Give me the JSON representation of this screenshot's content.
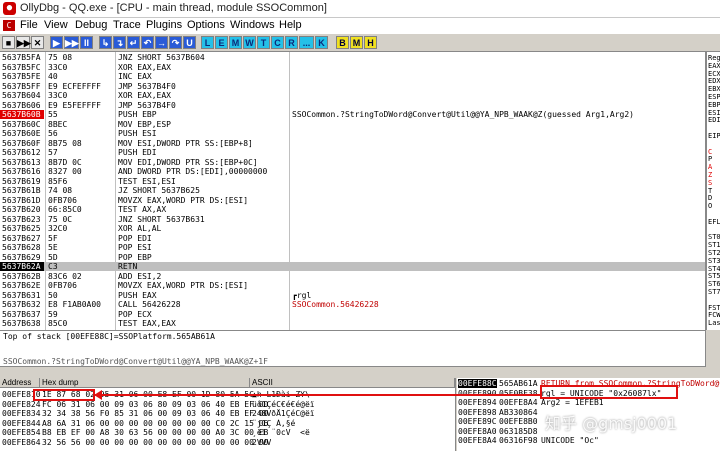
{
  "window": {
    "title": "OllyDbg - QQ.exe - [CPU - main thread, module SSOCommon]"
  },
  "menu": [
    "File",
    "View",
    "Debug",
    "Trace",
    "Plugins",
    "Options",
    "Windows",
    "Help"
  ],
  "toolbar": {
    "buttons": [
      "▶▶",
      "■",
      "✕",
      "▶",
      "▶▶",
      "II",
      "↳",
      "↴",
      "↵",
      "↶",
      "→",
      "↷",
      "U"
    ],
    "letters": [
      "L",
      "E",
      "M",
      "W",
      "T",
      "C",
      "R",
      "...",
      "K",
      "B",
      "M",
      "H"
    ]
  },
  "cpu_rows": [
    {
      "addr": "5637B5FA",
      "bytes": "75 08",
      "dis": "JNZ SHORT 5637B604",
      "cmt": ""
    },
    {
      "addr": "5637B5FC",
      "bytes": "33C0",
      "dis": "XOR EAX,EAX",
      "cmt": ""
    },
    {
      "addr": "5637B5FE",
      "bytes": "40",
      "dis": "INC EAX",
      "cmt": ""
    },
    {
      "addr": "5637B5FF",
      "bytes": "E9 ECFEFFFF",
      "dis": "JMP 5637B4F0",
      "cmt": ""
    },
    {
      "addr": "5637B604",
      "bytes": "33C0",
      "dis": "XOR EAX,EAX",
      "cmt": ""
    },
    {
      "addr": "5637B606",
      "bytes": "E9 E5FEFFFF",
      "dis": "JMP 5637B4F0",
      "cmt": ""
    },
    {
      "addr": "5637B60B",
      "bytes": "55",
      "dis": "PUSH EBP",
      "cmt": "SSOCommon.?StringToDWord@Convert@Util@@YA_NPB_WAAK@Z(guessed Arg1,Arg2)"
    },
    {
      "addr": "5637B60C",
      "bytes": "8BEC",
      "dis": "MOV EBP,ESP",
      "cmt": ""
    },
    {
      "addr": "5637B60E",
      "bytes": "56",
      "dis": "PUSH ESI",
      "cmt": ""
    },
    {
      "addr": "5637B60F",
      "bytes": "8B75 08",
      "dis": "MOV ESI,DWORD PTR SS:[EBP+8]",
      "cmt": ""
    },
    {
      "addr": "5637B612",
      "bytes": "57",
      "dis": "PUSH EDI",
      "cmt": ""
    },
    {
      "addr": "5637B613",
      "bytes": "8B7D 0C",
      "dis": "MOV EDI,DWORD PTR SS:[EBP+0C]",
      "cmt": ""
    },
    {
      "addr": "5637B616",
      "bytes": "8327 00",
      "dis": "AND DWORD PTR DS:[EDI],00000000",
      "cmt": ""
    },
    {
      "addr": "5637B619",
      "bytes": "85F6",
      "dis": "TEST ESI,ESI",
      "cmt": ""
    },
    {
      "addr": "5637B61B",
      "bytes": "74 08",
      "dis": "JZ SHORT 5637B625",
      "cmt": ""
    },
    {
      "addr": "5637B61D",
      "bytes": "0FB706",
      "dis": "MOVZX EAX,WORD PTR DS:[ESI]",
      "cmt": ""
    },
    {
      "addr": "5637B620",
      "bytes": "66:85C0",
      "dis": "TEST AX,AX",
      "cmt": ""
    },
    {
      "addr": "5637B623",
      "bytes": "75 0C",
      "dis": "JNZ SHORT 5637B631",
      "cmt": ""
    },
    {
      "addr": "5637B625",
      "bytes": "32C0",
      "dis": "XOR AL,AL",
      "cmt": ""
    },
    {
      "addr": "5637B627",
      "bytes": "5F",
      "dis": "POP EDI",
      "cmt": ""
    },
    {
      "addr": "5637B628",
      "bytes": "5E",
      "dis": "POP ESI",
      "cmt": ""
    },
    {
      "addr": "5637B629",
      "bytes": "5D",
      "dis": "POP EBP",
      "cmt": ""
    },
    {
      "addr": "5637B62A",
      "bytes": "C3",
      "dis": "RETN",
      "cmt": ""
    },
    {
      "addr": "5637B62B",
      "bytes": "83C6 02",
      "dis": "ADD ESI,2",
      "cmt": ""
    },
    {
      "addr": "5637B62E",
      "bytes": "0FB706",
      "dis": "MOVZX EAX,WORD PTR DS:[ESI]",
      "cmt": ""
    },
    {
      "addr": "5637B631",
      "bytes": "50",
      "dis": "PUSH EAX",
      "cmt": "┏rgl"
    },
    {
      "addr": "5637B632",
      "bytes": "E8 F1AB0A00",
      "dis": "CALL 56426228",
      "cmt": "SSOCommon.56426228"
    },
    {
      "addr": "5637B637",
      "bytes": "59",
      "dis": "POP ECX",
      "cmt": ""
    },
    {
      "addr": "5637B638",
      "bytes": "85C0",
      "dis": "TEST EAX,EAX",
      "cmt": ""
    }
  ],
  "registers": [
    "Reg",
    "EAX",
    "ECX",
    "EDX",
    "EBX",
    "ESP",
    "EBP",
    "ESI",
    "EDI",
    "",
    "EIP",
    "",
    "C",
    "P",
    "A",
    "Z",
    "S",
    "T",
    "D",
    "O",
    "",
    "EFL",
    "",
    "ST0",
    "ST1",
    "ST2",
    "ST3",
    "ST4",
    "ST5",
    "ST6",
    "ST7",
    "",
    "FST",
    "FCW",
    "Las"
  ],
  "info": {
    "line1": "Top of stack [00EFE88C]=SSOPlatform.565AB61A",
    "line2": "SSOCommon.?StringToDWord@Convert@Util@@YA_NPB_WAAK@Z+1F"
  },
  "dump": {
    "headers": [
      "Address",
      "Hex dump",
      "ASCII"
    ],
    "rows": [
      {
        "addr": "00EFE810",
        "hex": "1E 87 68 02 95 31 06 00 E8 EF 00 1D 80 5A 5C",
        "ascii": "▲h L1Ðài  ZY\\"
      },
      {
        "addr": "00EFE824",
        "hex": "FC 06 31 06 00 09 03 06 80 09 03 06 40 EB EF 00",
        "ascii": "üô1ÇéC€é€é@ëï"
      },
      {
        "addr": "00EFE834",
        "hex": "32 34 38 56 F0 85 31 06 00 09 03 06 40 EB EF 00",
        "ascii": "248VðÅ1ÇéC@ëï"
      },
      {
        "addr": "00EFE844",
        "hex": "A8 6A 31 06 00 00 00 00 00 00 00 00 C0 2C 15 06",
        "ascii": "¨j1Ç À,§é"
      },
      {
        "addr": "00EFE854",
        "hex": "B8 EB EF 00 A8 30 63 56 00 00 00 00 A0 3C 00 EB",
        "ascii": "¸ëï ¨0cV   <ë"
      },
      {
        "addr": "00EFE864",
        "hex": "32 56 56 00 00 00 00 00 00 00 00 00 00 00 00 00",
        "ascii": "2VVV"
      }
    ]
  },
  "stack": {
    "rows": [
      {
        "addr": "00EFE88C",
        "val": "565AB61A",
        "cmt": "RETURN from SSOCommon.?StringToDWord@C"
      },
      {
        "addr": "00EFE890",
        "val": "05F0BF38",
        "cmt": "rgl = UNICODE \"0x26087lx\""
      },
      {
        "addr": "00EFE894",
        "val": "00EFE8A4",
        "cmt": "Arg2 = 1EFEB1"
      },
      {
        "addr": "00EFE898",
        "val": "AB330864",
        "cmt": ""
      },
      {
        "addr": "00EFE89C",
        "val": "00EFE8B0",
        "cmt": ""
      },
      {
        "addr": "00EFE8A0",
        "val": "063185D8",
        "cmt": ""
      },
      {
        "addr": "00EFE8A4",
        "val": "06316F98",
        "cmt": "UNICODE \"Oc\""
      }
    ]
  },
  "watermark": "知乎 @gmsj0001"
}
